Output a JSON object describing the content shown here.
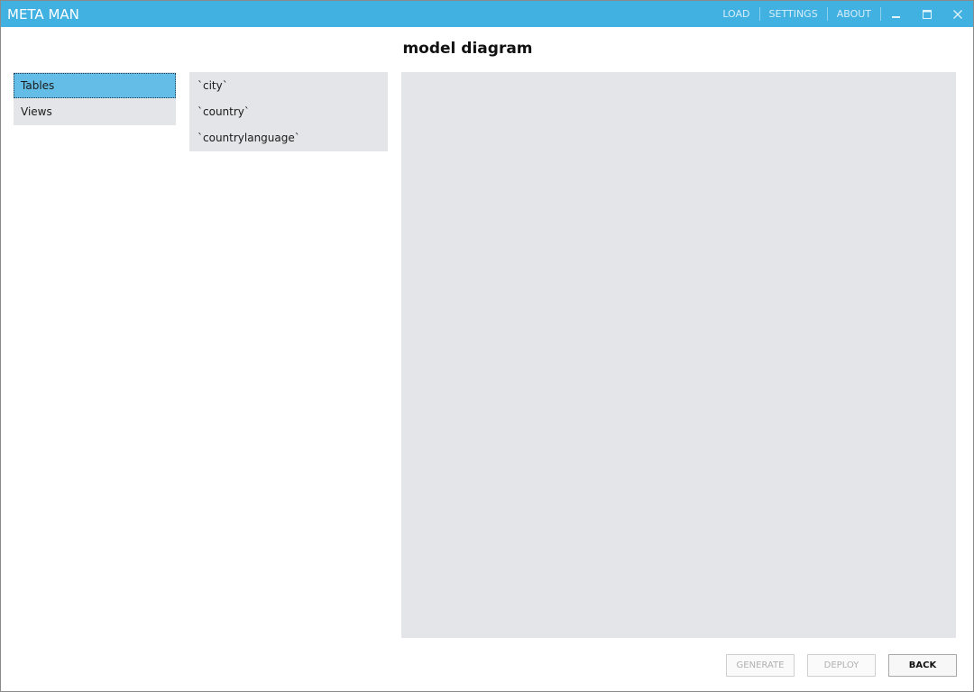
{
  "titlebar": {
    "app_title": "META MAN",
    "menu": [
      "LOAD",
      "SETTINGS",
      "ABOUT"
    ]
  },
  "page": {
    "title": "model diagram"
  },
  "categories": [
    {
      "label": "Tables",
      "selected": true
    },
    {
      "label": "Views",
      "selected": false
    }
  ],
  "tables": [
    "`city`",
    "`country`",
    "`countrylanguage`"
  ],
  "buttons": {
    "generate": "GENERATE",
    "deploy": "DEPLOY",
    "back": "BACK"
  },
  "colors": {
    "accent": "#41b1e1",
    "selection": "#63bde6",
    "panel_bg": "#e4e5e9"
  }
}
